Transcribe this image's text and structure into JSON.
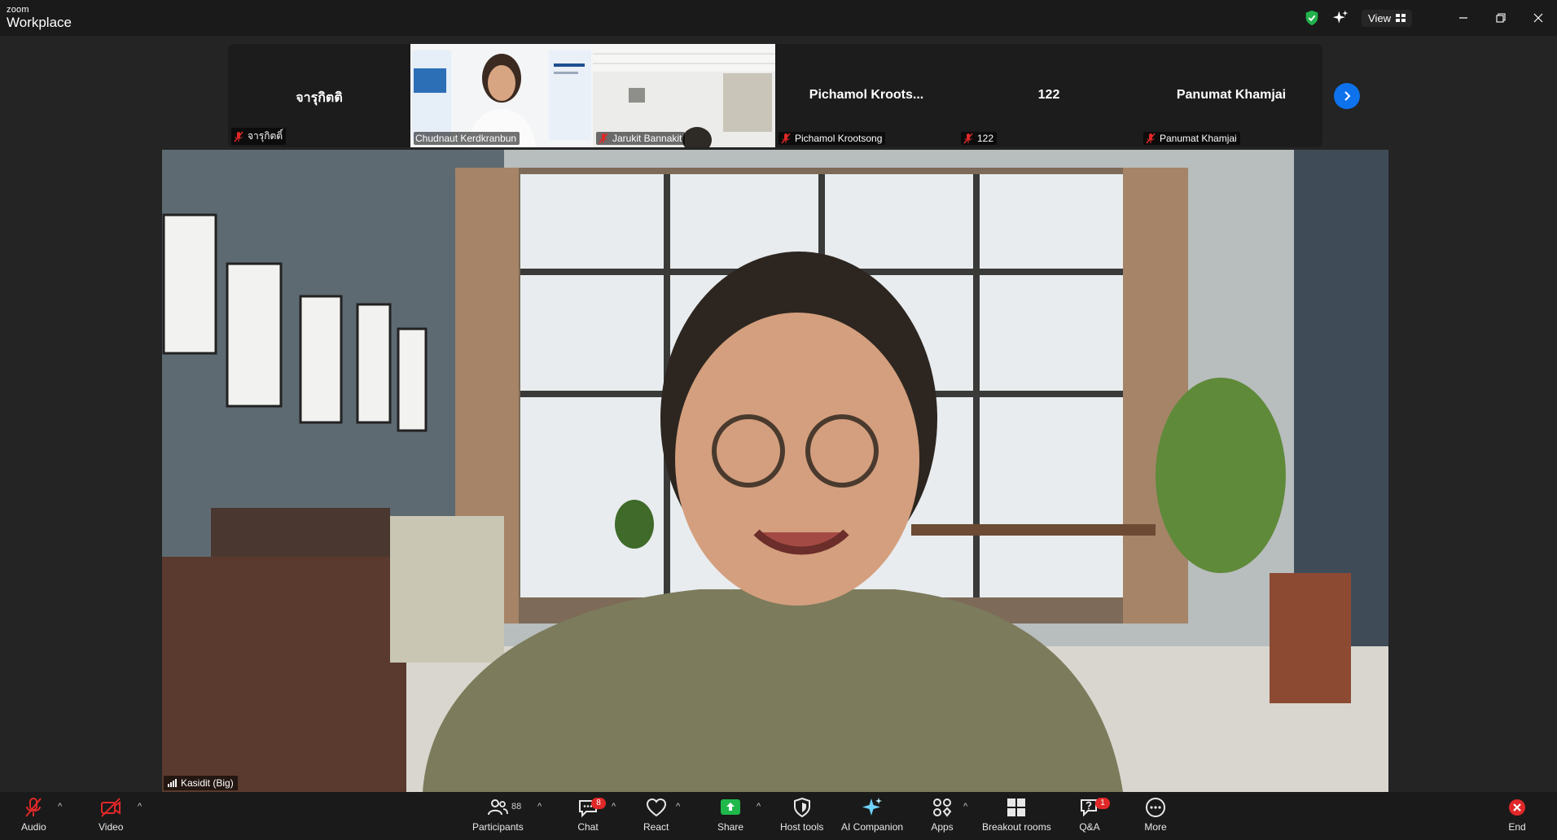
{
  "app": {
    "brand_small": "zoom",
    "brand_big": "Workplace"
  },
  "titlebar": {
    "view_label": "View"
  },
  "strip": {
    "tiles": [
      {
        "display_name": "จารุกิตติ",
        "label": "จารุกิตติ์"
      },
      {
        "display_name": "",
        "label": "Chudnaut Kerdkranbun"
      },
      {
        "display_name": "",
        "label": "Jarukit Bannakit"
      },
      {
        "display_name": "Pichamol  Kroots...",
        "label": "Pichamol Krootsong"
      },
      {
        "display_name": "122",
        "label": "122"
      },
      {
        "display_name": "Panumat Khamjai",
        "label": "Panumat Khamjai"
      }
    ]
  },
  "main_video": {
    "speaker_label": "Kasidit (Big)"
  },
  "toolbar": {
    "audio": "Audio",
    "video": "Video",
    "participants": "Participants",
    "participants_count": "88",
    "chat": "Chat",
    "chat_badge": "8",
    "react": "React",
    "share": "Share",
    "host_tools": "Host tools",
    "ai_companion": "AI Companion",
    "apps": "Apps",
    "breakout_rooms": "Breakout rooms",
    "qa": "Q&A",
    "qa_badge": "1",
    "more": "More",
    "end": "End"
  },
  "colors": {
    "accent": "#0e72ed",
    "danger": "#e02828",
    "share_green": "#1fb84b",
    "shield_green": "#22b14c"
  }
}
